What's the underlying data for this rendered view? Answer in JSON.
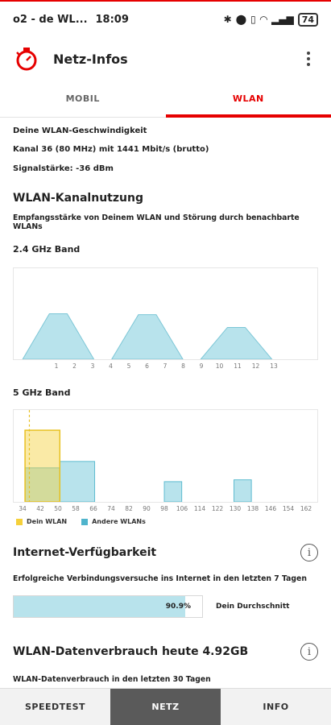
{
  "status": {
    "carrier": "o2 - de WL...",
    "time": "18:09",
    "battery": "74"
  },
  "app": {
    "title": "Netz-Infos"
  },
  "tabs": [
    {
      "label": "MOBIL"
    },
    {
      "label": "WLAN"
    }
  ],
  "wlan_info": {
    "heading": "Deine WLAN-Geschwindigkeit",
    "channel": "Kanal 36 (80 MHz) mit 1441 Mbit/s (brutto)",
    "signal": "Signalstärke: -36 dBm"
  },
  "channel_usage": {
    "title": "WLAN-Kanalnutzung",
    "subtitle": "Empfangsstärke von Deinem WLAN und Störung durch benachbarte WLANs",
    "band24_label": "2.4 GHz Band",
    "band5_label": "5 GHz Band",
    "legend_own": "Dein WLAN",
    "legend_other": "Andere WLANs"
  },
  "availability": {
    "title": "Internet-Verfügbarkeit",
    "subtitle": "Erfolgreiche Verbindungsversuche ins Internet in den letzten 7 Tagen",
    "value_label": "90.9%",
    "value": 0.909,
    "average_label": "Dein Durchschnitt"
  },
  "data_usage": {
    "title": "WLAN-Datenverbrauch heute 4.92GB",
    "subtitle": "WLAN-Datenverbrauch in den letzten 30 Tagen"
  },
  "bottom_nav": [
    {
      "label": "SPEEDTEST"
    },
    {
      "label": "NETZ"
    },
    {
      "label": "INFO"
    }
  ],
  "colors": {
    "accent": "#e60000",
    "own_wlan": "#f5d03a",
    "other_wlan": "#8fd2e0"
  },
  "chart_data": [
    {
      "type": "area",
      "title": "2.4 GHz Band",
      "categories": [
        "1",
        "2",
        "3",
        "4",
        "5",
        "6",
        "7",
        "8",
        "9",
        "10",
        "11",
        "12",
        "13"
      ],
      "series": [
        {
          "name": "Andere WLANs",
          "networks": [
            {
              "channel_from": -1,
              "channel_to": 3,
              "peak_from": 0.5,
              "peak_to": 1.5,
              "level": 0.5
            },
            {
              "channel_from": 4,
              "channel_to": 8,
              "peak_from": 5.5,
              "peak_to": 6.5,
              "level": 0.49
            },
            {
              "channel_from": 9,
              "channel_to": 13,
              "peak_from": 10.5,
              "peak_to": 11.5,
              "level": 0.35
            }
          ]
        }
      ]
    },
    {
      "type": "bar",
      "title": "5 GHz Band",
      "categories": [
        "34",
        "42",
        "50",
        "58",
        "66",
        "74",
        "82",
        "90",
        "98",
        "106",
        "114",
        "122",
        "130",
        "138",
        "146",
        "154",
        "162"
      ],
      "series": [
        {
          "name": "Dein WLAN",
          "bars": [
            {
              "from": 34,
              "to": 50,
              "level": 0.78
            }
          ]
        },
        {
          "name": "Andere WLANs",
          "bars": [
            {
              "from": 34,
              "to": 50,
              "level": 0.37
            },
            {
              "from": 50,
              "to": 66,
              "level": 0.44
            },
            {
              "from": 98,
              "to": 106,
              "level": 0.22
            },
            {
              "from": 130,
              "to": 138,
              "level": 0.24
            }
          ]
        }
      ],
      "marker_channel": 36
    }
  ]
}
